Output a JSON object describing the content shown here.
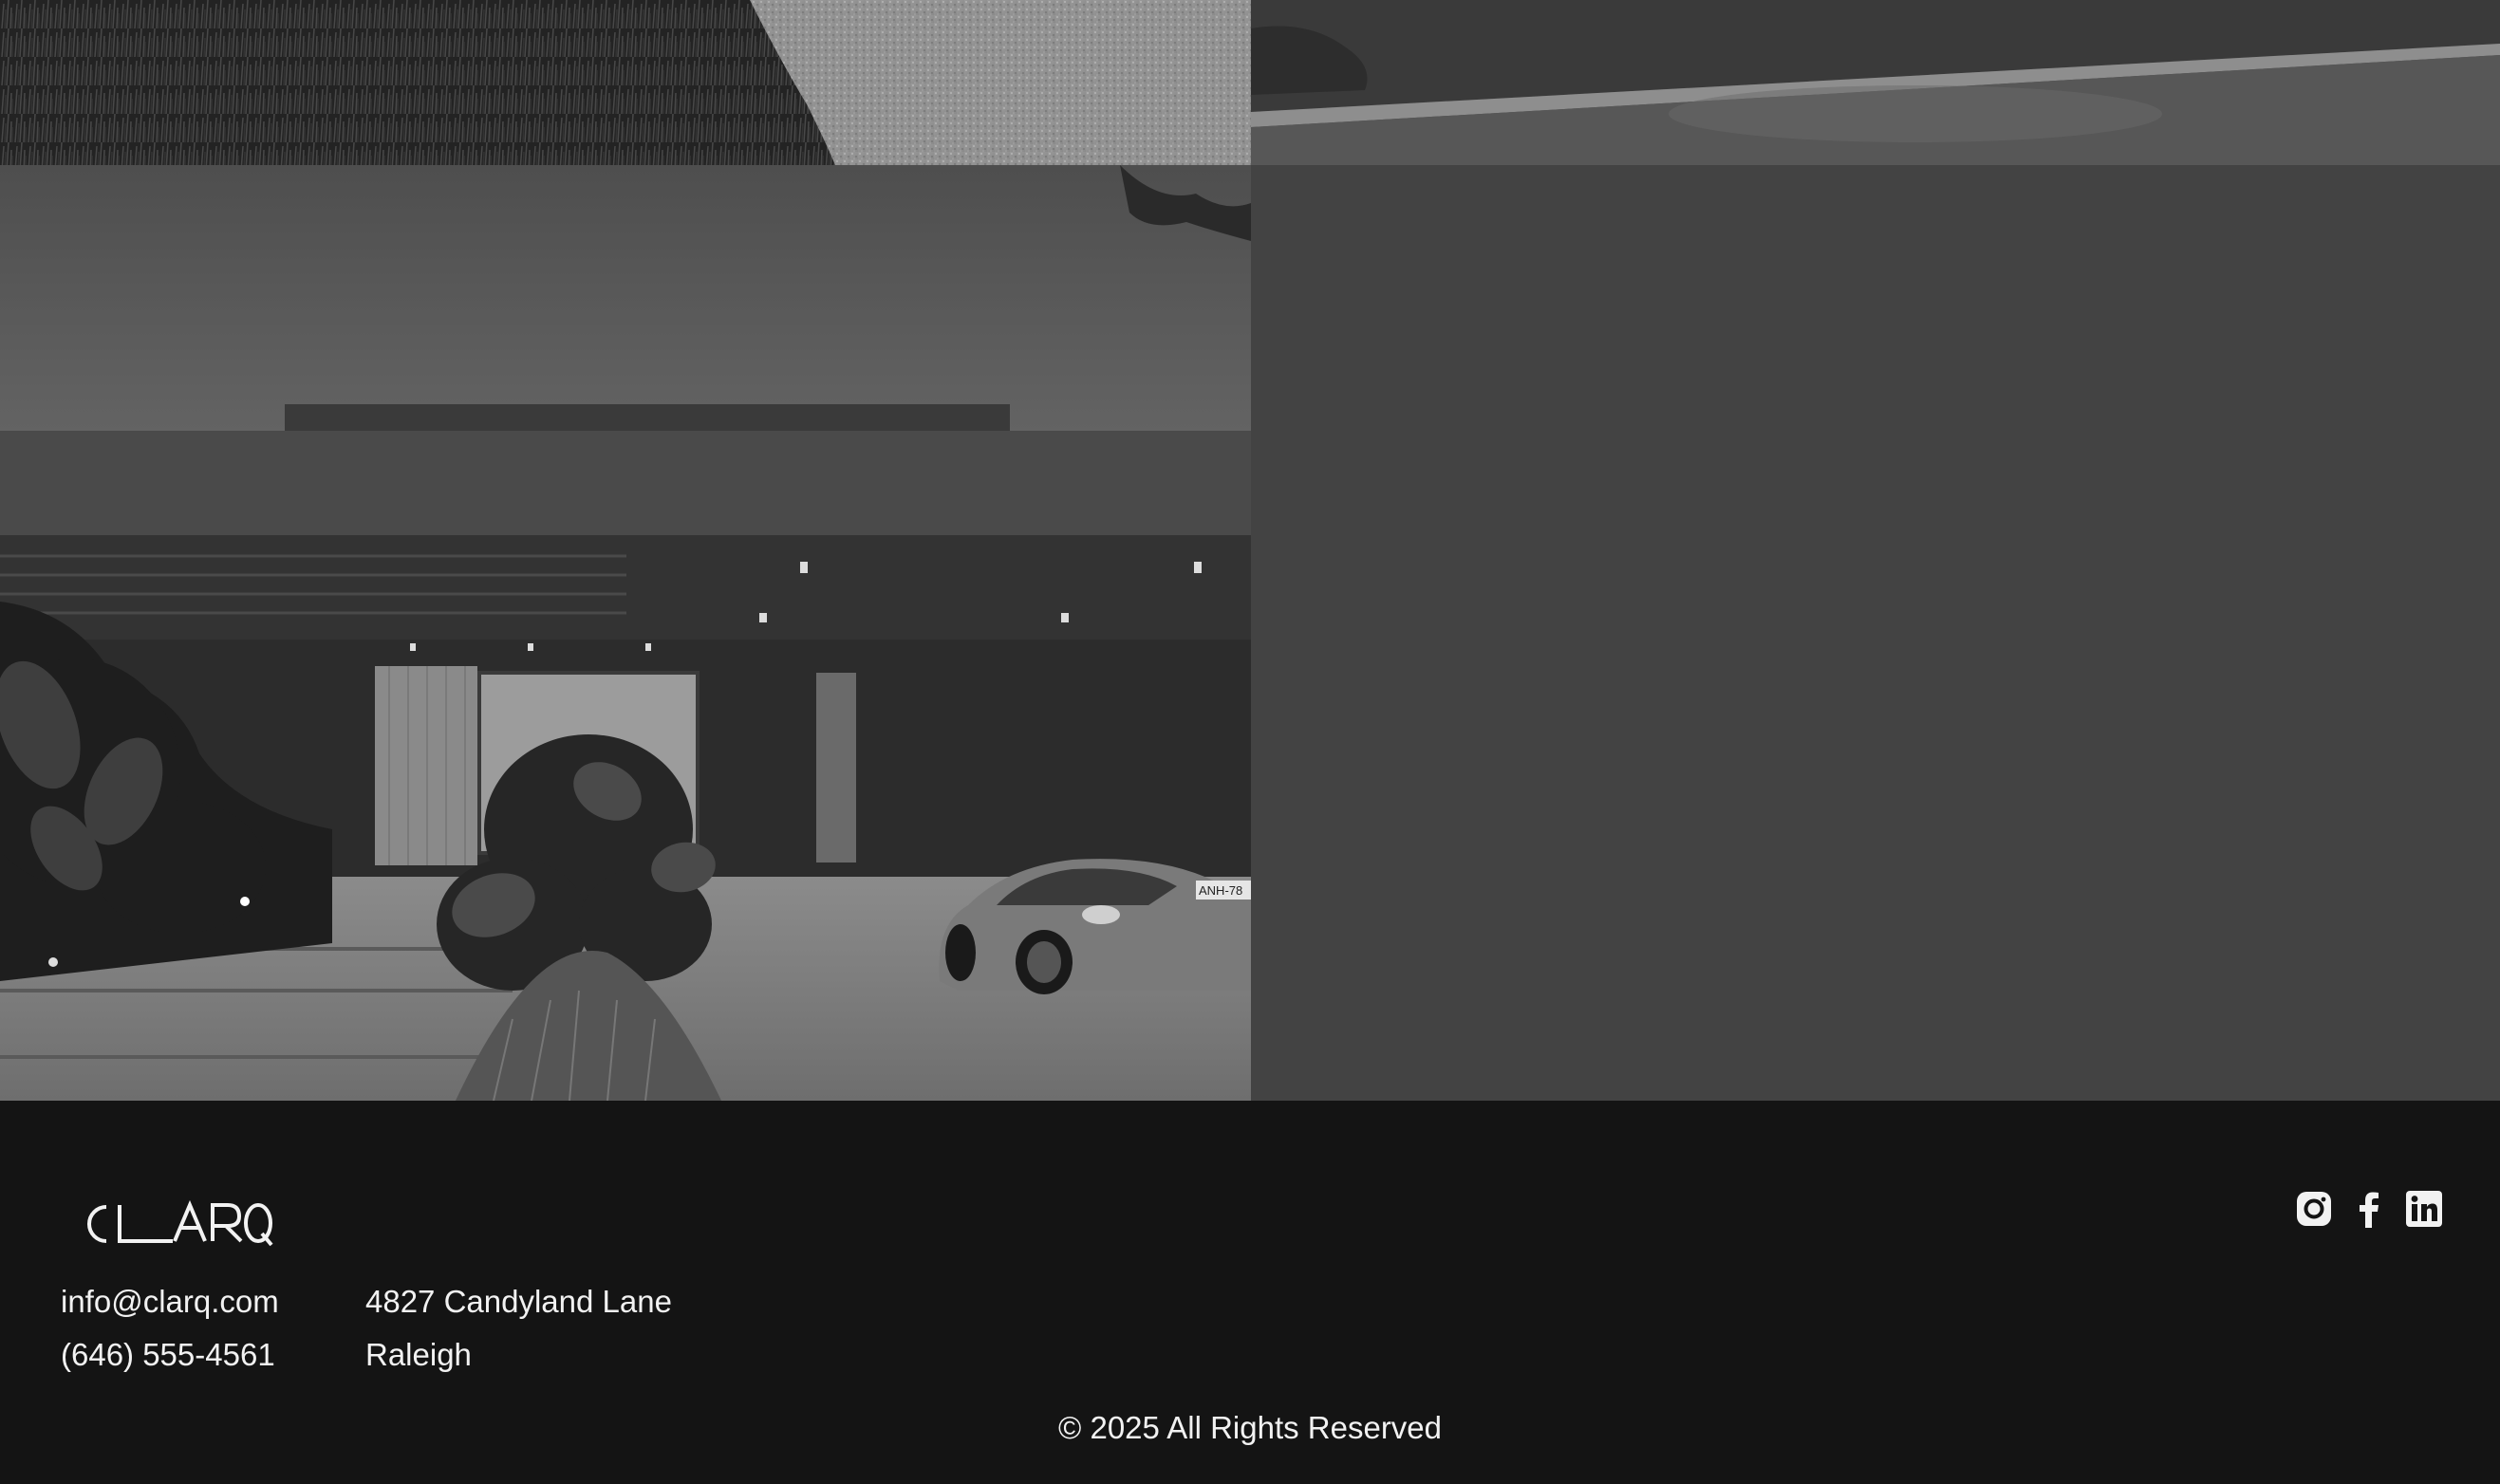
{
  "brand": {
    "logo_text": "CL_ARQ"
  },
  "gallery": {
    "tiles": [
      {
        "icon": "grass-gravel-photo"
      },
      {
        "icon": "lawn-sidewalk-photo"
      },
      {
        "icon": "modern-house-with-car-photo"
      },
      {
        "icon": "empty-placeholder"
      }
    ],
    "car_plate": "ANH-78"
  },
  "footer": {
    "email": "info@clarq.com",
    "phone": "(646) 555-4561",
    "address_line1": "4827 Candyland Lane",
    "address_line2": "Raleigh",
    "copyright": "© 2025 All Rights Reserved",
    "social": [
      {
        "icon": "instagram-icon"
      },
      {
        "icon": "facebook-icon"
      },
      {
        "icon": "linkedin-icon"
      }
    ]
  },
  "colors": {
    "footer_bg": "#141414",
    "placeholder_bg": "#434343",
    "text": "#f2f2f2"
  }
}
